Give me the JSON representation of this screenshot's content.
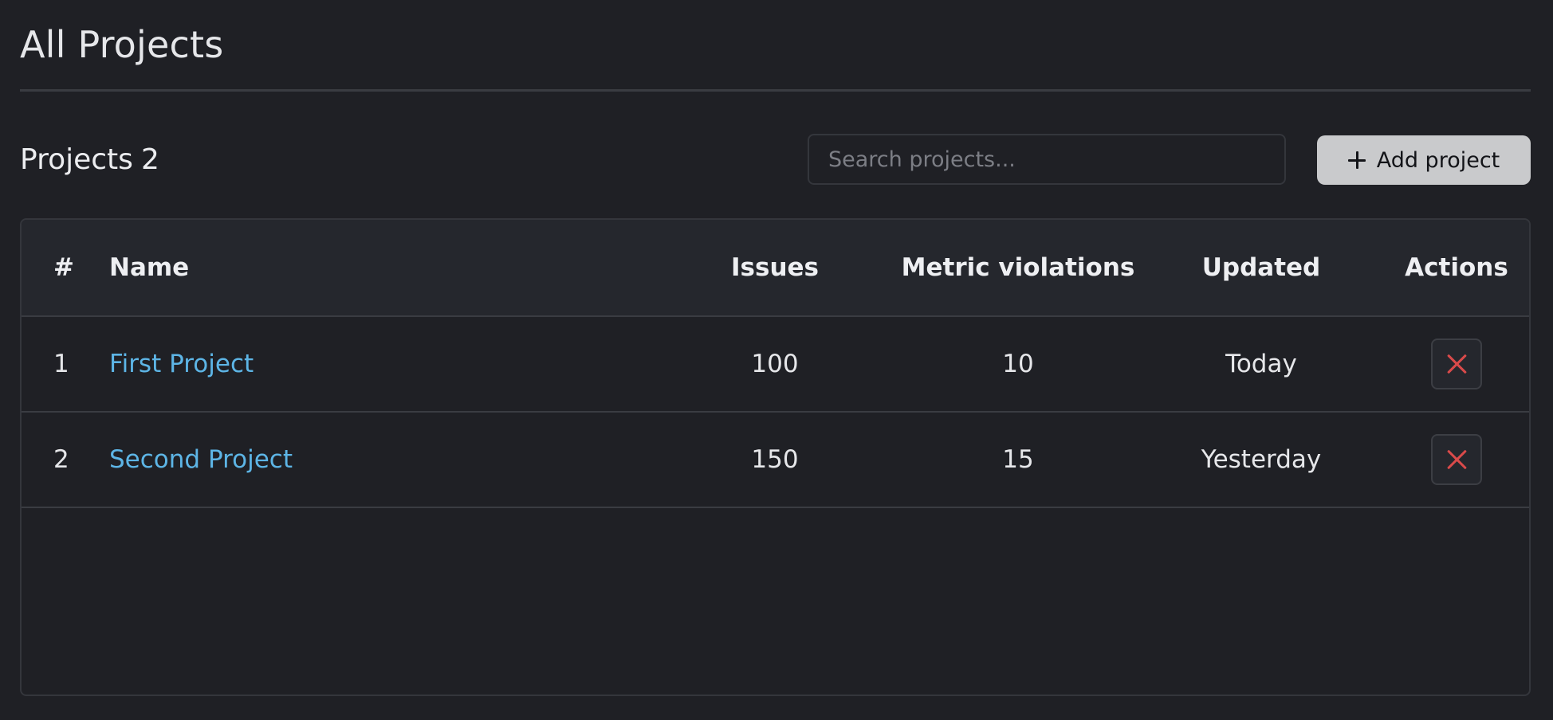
{
  "page": {
    "title": "All Projects"
  },
  "toolbar": {
    "projects_label": "Projects",
    "projects_count": "2",
    "search_placeholder": "Search projects...",
    "search_value": "",
    "add_button_label": "Add project",
    "add_button_icon": "plus-icon"
  },
  "table": {
    "columns": [
      "#",
      "Name",
      "Issues",
      "Metric violations",
      "Updated",
      "Actions"
    ],
    "rows": [
      {
        "index": "1",
        "name": "First Project",
        "issues": "100",
        "metric_violations": "10",
        "updated": "Today",
        "action_icon": "close-icon"
      },
      {
        "index": "2",
        "name": "Second Project",
        "issues": "150",
        "metric_violations": "15",
        "updated": "Yesterday",
        "action_icon": "close-icon"
      }
    ]
  },
  "colors": {
    "background": "#1f2025",
    "header_background": "#25272d",
    "link": "#5db5e6",
    "delete_icon": "#d94a4a",
    "primary_button": "#c9cacc"
  }
}
